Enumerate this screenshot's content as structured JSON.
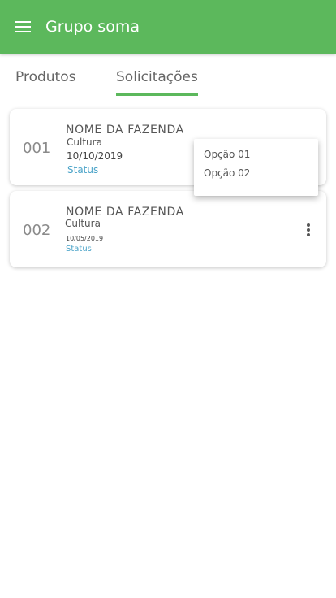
{
  "appbar": {
    "title": "Grupo soma",
    "menu_icon": "hamburger-menu-icon",
    "color": "#5cb85c"
  },
  "tabs": [
    {
      "label": "Produtos",
      "active": false
    },
    {
      "label": "Solicitações",
      "active": true
    }
  ],
  "requests": [
    {
      "id": "001",
      "farm_name": "NOME DA FAZENDA",
      "culture": "Cultura",
      "date": "10/10/2019",
      "status": "Status"
    },
    {
      "id": "002",
      "farm_name": "NOME DA FAZENDA",
      "culture": "Cultura",
      "date": "10/05/2019",
      "status": "Status",
      "more_icon": "more-vertical-icon"
    }
  ],
  "popup_menu": {
    "options": [
      "Opção 01",
      "Opção 02"
    ]
  },
  "colors": {
    "accent": "#5cb85c",
    "status": "#4aa3c8"
  }
}
